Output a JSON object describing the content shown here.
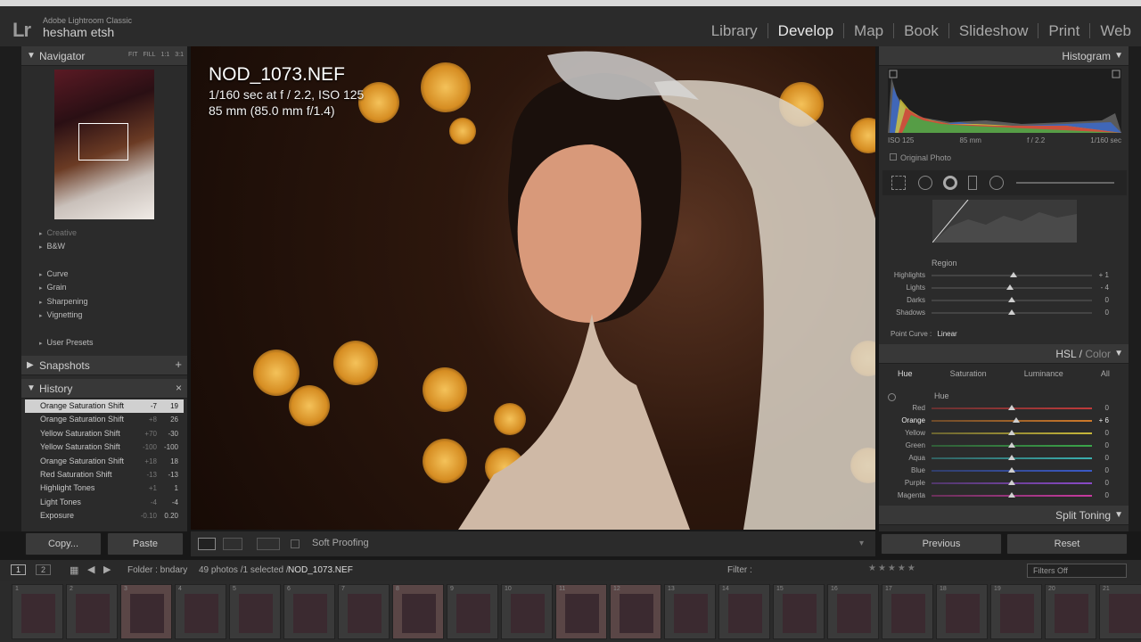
{
  "app": {
    "name": "Adobe Lightroom Classic",
    "user": "hesham etsh",
    "logo": "Lr"
  },
  "modules": [
    "Library",
    "Develop",
    "Map",
    "Book",
    "Slideshow",
    "Print",
    "Web"
  ],
  "navigator": {
    "title": "Navigator",
    "options": [
      "FIT",
      "FILL",
      "1:1",
      "3:1"
    ]
  },
  "presets": {
    "partial": "Creative",
    "items": [
      "B&W",
      "Curve",
      "Grain",
      "Sharpening",
      "Vignetting",
      "User Presets"
    ]
  },
  "snapshots": {
    "title": "Snapshots",
    "add": "+"
  },
  "history": {
    "title": "History",
    "close": "×",
    "items": [
      {
        "label": "Orange Saturation Shift",
        "d": "-7",
        "v": "19"
      },
      {
        "label": "Orange Saturation Shift",
        "d": "+8",
        "v": "26"
      },
      {
        "label": "Yellow Saturation Shift",
        "d": "+70",
        "v": "-30"
      },
      {
        "label": "Yellow Saturation Shift",
        "d": "-100",
        "v": "-100"
      },
      {
        "label": "Orange Saturation Shift",
        "d": "+18",
        "v": "18"
      },
      {
        "label": "Red Saturation Shift",
        "d": "-13",
        "v": "-13"
      },
      {
        "label": "Highlight Tones",
        "d": "+1",
        "v": "1"
      },
      {
        "label": "Light Tones",
        "d": "-4",
        "v": "-4"
      },
      {
        "label": "Exposure",
        "d": "-0.10",
        "v": "0.20"
      }
    ]
  },
  "leftbuttons": {
    "copy": "Copy...",
    "paste": "Paste"
  },
  "photo": {
    "filename": "NOD_1073.NEF",
    "exposure": "1/160 sec at f / 2.2, ISO 125",
    "lens": "85 mm (85.0 mm f/1.4)"
  },
  "toolbar": {
    "soft_proofing": "Soft Proofing"
  },
  "histogram": {
    "title": "Histogram",
    "iso": "ISO 125",
    "focal": "85 mm",
    "aperture": "f / 2.2",
    "shutter": "1/160 sec",
    "original": "Original Photo"
  },
  "tonecurve": {
    "region": "Region",
    "sliders": [
      {
        "label": "Highlights",
        "value": "+ 1",
        "pos": 0.51
      },
      {
        "label": "Lights",
        "value": "- 4",
        "pos": 0.49
      },
      {
        "label": "Darks",
        "value": "0",
        "pos": 0.5
      },
      {
        "label": "Shadows",
        "value": "0",
        "pos": 0.5
      }
    ],
    "point_curve_label": "Point Curve :",
    "point_curve_value": "Linear"
  },
  "hsl": {
    "title_hsl": "HSL",
    "title_color": "Color",
    "tabs": [
      "Hue",
      "Saturation",
      "Luminance",
      "All"
    ],
    "section": "Hue",
    "sliders": [
      {
        "label": "Red",
        "value": "0",
        "pos": 0.5,
        "color": "#c03a3a"
      },
      {
        "label": "Orange",
        "value": "+ 6",
        "pos": 0.53,
        "color": "#d07a2a"
      },
      {
        "label": "Yellow",
        "value": "0",
        "pos": 0.5,
        "color": "#c8b83a"
      },
      {
        "label": "Green",
        "value": "0",
        "pos": 0.5,
        "color": "#3aa64a"
      },
      {
        "label": "Aqua",
        "value": "0",
        "pos": 0.5,
        "color": "#3ab0b0"
      },
      {
        "label": "Blue",
        "value": "0",
        "pos": 0.5,
        "color": "#3a5ac8"
      },
      {
        "label": "Purple",
        "value": "0",
        "pos": 0.5,
        "color": "#8a4ac8"
      },
      {
        "label": "Magenta",
        "value": "0",
        "pos": 0.5,
        "color": "#c83aa0"
      }
    ]
  },
  "splittoning": {
    "title": "Split Toning"
  },
  "rightbuttons": {
    "previous": "Previous",
    "reset": "Reset"
  },
  "filterbar": {
    "folder": "Folder : bndary",
    "count": "49 photos /1 selected /",
    "selected": "NOD_1073.NEF",
    "filter": "Filter :",
    "filters_off": "Filters Off",
    "page1": "1",
    "page2": "2"
  },
  "filmstrip": {
    "numbers": [
      "1",
      "2",
      "3",
      "4",
      "5",
      "6",
      "7",
      "8",
      "9",
      "10",
      "11",
      "12",
      "13",
      "14",
      "15",
      "16",
      "17",
      "18",
      "19",
      "20",
      "21"
    ]
  }
}
